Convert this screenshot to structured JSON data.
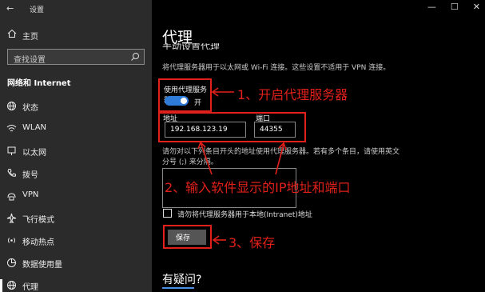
{
  "window": {
    "app_title": "设置",
    "controls": [
      "—",
      "☐",
      "✕"
    ]
  },
  "sidebar": {
    "home_label": "主页",
    "search_placeholder": "查找设置",
    "section_title": "网络和 Internet",
    "items": [
      {
        "label": "状态",
        "icon": "globe-icon"
      },
      {
        "label": "WLAN",
        "icon": "wifi-icon"
      },
      {
        "label": "以太网",
        "icon": "ethernet-icon"
      },
      {
        "label": "拨号",
        "icon": "phone-icon"
      },
      {
        "label": "VPN",
        "icon": "vpn-icon"
      },
      {
        "label": "飞行模式",
        "icon": "airplane-icon"
      },
      {
        "label": "移动热点",
        "icon": "hotspot-icon"
      },
      {
        "label": "数据使用量",
        "icon": "data-usage-icon"
      },
      {
        "label": "代理",
        "icon": "globe-icon"
      }
    ]
  },
  "main": {
    "title": "代理",
    "section_heading": "手动设置代理",
    "description": "将代理服务器用于以太网或 Wi-Fi 连接。这些设置不适用于 VPN 连接。",
    "use_proxy": {
      "label": "使用代理服务器",
      "state": "开",
      "on": true
    },
    "address": {
      "label": "地址",
      "value": "192.168.123.19"
    },
    "port": {
      "label": "端口",
      "value": "44355"
    },
    "exceptions_description": "请勿对以下列条目开头的地址使用代理服务器。若有多个条目，请使用英文分号 (;) 来分隔。",
    "exceptions_value": "",
    "local_bypass_label": "请勿将代理服务器用于本地(Intranet)地址",
    "save_label": "保存",
    "help_title": "有疑问?"
  },
  "annotations": {
    "step1": "1、开启代理服务器",
    "step2": "2、输入软件显示的IP地址和端口",
    "step3": "3、保存",
    "color": "#e0201a"
  },
  "colors": {
    "sidebar_bg": "#2b2b2b",
    "main_bg": "#000000",
    "accent": "#2f7bd8",
    "highlight_red": "#e0201a"
  }
}
